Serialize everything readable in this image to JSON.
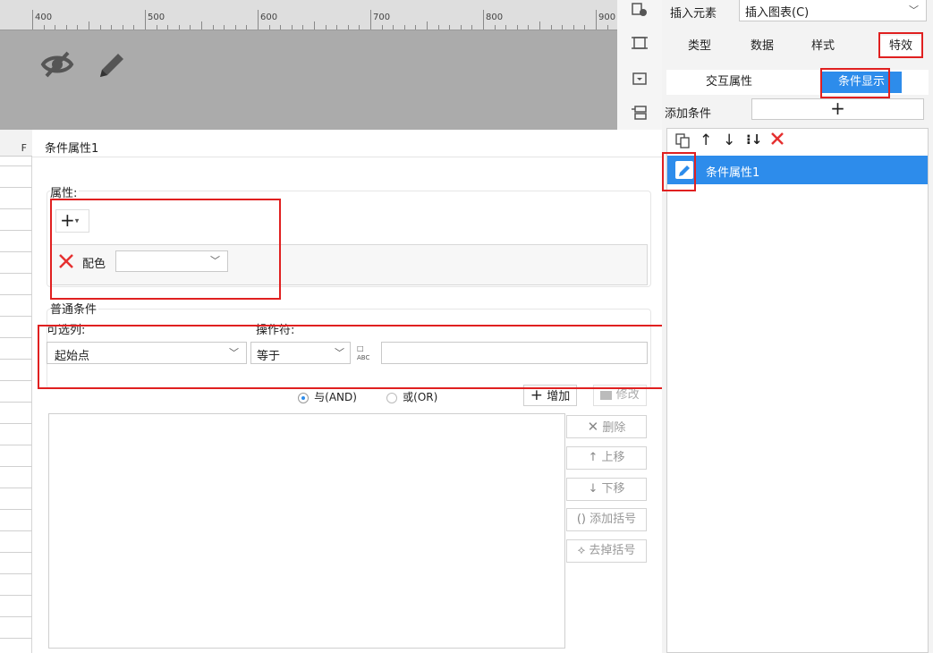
{
  "ruler": {
    "marks": [
      "400",
      "500",
      "600",
      "700",
      "800",
      "900"
    ]
  },
  "canvas": {
    "icons": [
      "eye-off-icon",
      "pencil-icon"
    ]
  },
  "sheet": {
    "column_label": "F"
  },
  "right_panel": {
    "insert_element_label": "插入元素",
    "insert_chart_label": "插入图表(C)",
    "tabs": [
      "类型",
      "数据",
      "样式",
      "特效"
    ],
    "subtabs": [
      "交互属性",
      "条件显示"
    ],
    "add_condition_label": "添加条件",
    "add_symbol": "+",
    "list_items": [
      "条件属性1"
    ]
  },
  "dialog": {
    "title": "条件属性1",
    "attr_section_label": "属性:",
    "add_attr_symbol": "+",
    "attr_item_label": "配色",
    "attr_item_value": "",
    "common_cond_label": "普通条件",
    "optional_column_label": "可选列:",
    "operator_label": "操作符:",
    "column_value": "起始点",
    "operator_value": "等于",
    "value_input": "",
    "and_label": "与(AND)",
    "or_label": "或(OR)",
    "add_button": "增加",
    "modify_button": "修改",
    "delete_button": "删除",
    "move_up_button": "上移",
    "move_down_button": "下移",
    "add_paren_button": "添加括号",
    "remove_paren_button": "去掉括号"
  },
  "colors": {
    "highlight": "#e02020",
    "selected_blue": "#2d8ceb",
    "canvas_gray": "#ababab"
  }
}
